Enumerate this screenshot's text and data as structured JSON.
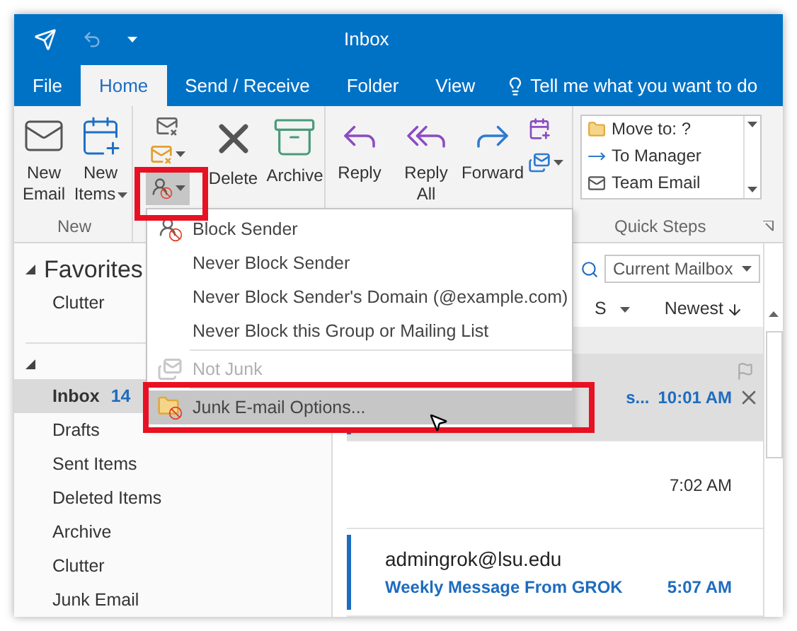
{
  "window": {
    "title": "Inbox"
  },
  "tabs": [
    {
      "label": "File",
      "selected": false
    },
    {
      "label": "Home",
      "selected": true
    },
    {
      "label": "Send / Receive",
      "selected": false
    },
    {
      "label": "Folder",
      "selected": false
    },
    {
      "label": "View",
      "selected": false
    }
  ],
  "tell_me": "Tell me what you want to do",
  "ribbon": {
    "new_group": {
      "label": "New",
      "buttons": [
        {
          "label": "New Email",
          "kind": "email"
        },
        {
          "label": "New Items",
          "kind": "items"
        }
      ]
    },
    "delete_buttons": [
      {
        "label": "Delete",
        "kind": "delete"
      },
      {
        "label": "Archive",
        "kind": "archive"
      }
    ],
    "respond_buttons": [
      {
        "label": "Reply",
        "kind": "reply"
      },
      {
        "label": "Reply All",
        "kind": "replyall"
      },
      {
        "label": "Forward",
        "kind": "forward"
      }
    ],
    "quick_steps": {
      "label": "Quick Steps",
      "items": [
        "Move to: ?",
        "To Manager",
        "Team Email"
      ]
    }
  },
  "junk_menu": [
    {
      "label": "Block Sender",
      "kind": "block",
      "disabled": false,
      "selected": false
    },
    {
      "label": "Never Block Sender",
      "kind": "plain",
      "disabled": false,
      "selected": false
    },
    {
      "label": "Never Block Sender's Domain (@example.com)",
      "kind": "plain",
      "disabled": false,
      "selected": false
    },
    {
      "label": "Never Block this Group or Mailing List",
      "kind": "plain",
      "disabled": false,
      "selected": false
    },
    {
      "label": "Not Junk",
      "kind": "notjunk",
      "disabled": true,
      "selected": false
    },
    {
      "label": "Junk E-mail Options...",
      "kind": "options",
      "disabled": false,
      "selected": true
    }
  ],
  "folders": {
    "favorites": {
      "label": "Favorites",
      "items": [
        {
          "label": "Clutter",
          "selected": false
        }
      ]
    },
    "mailbox": [
      {
        "label": "Inbox",
        "count": "14",
        "selected": true
      },
      {
        "label": "Drafts",
        "selected": false
      },
      {
        "label": "Sent Items",
        "selected": false
      },
      {
        "label": "Deleted Items",
        "selected": false
      },
      {
        "label": "Archive",
        "selected": false
      },
      {
        "label": "Clutter",
        "selected": false
      },
      {
        "label": "Junk Email",
        "selected": false
      }
    ]
  },
  "search": {
    "scope": "Current Mailbox"
  },
  "sort_row": {
    "filter_fragment": "S",
    "sort": "Newest"
  },
  "messages": [
    {
      "subject": "s...",
      "time": "10:01 AM",
      "unread": true,
      "selected": true
    },
    {
      "time": "7:02 AM",
      "unread": false,
      "selected": false
    },
    {
      "sender": "admingrok@lsu.edu",
      "subject": "Weekly Message From GROK",
      "time": "5:07 AM",
      "unread": true,
      "selected": false
    }
  ]
}
